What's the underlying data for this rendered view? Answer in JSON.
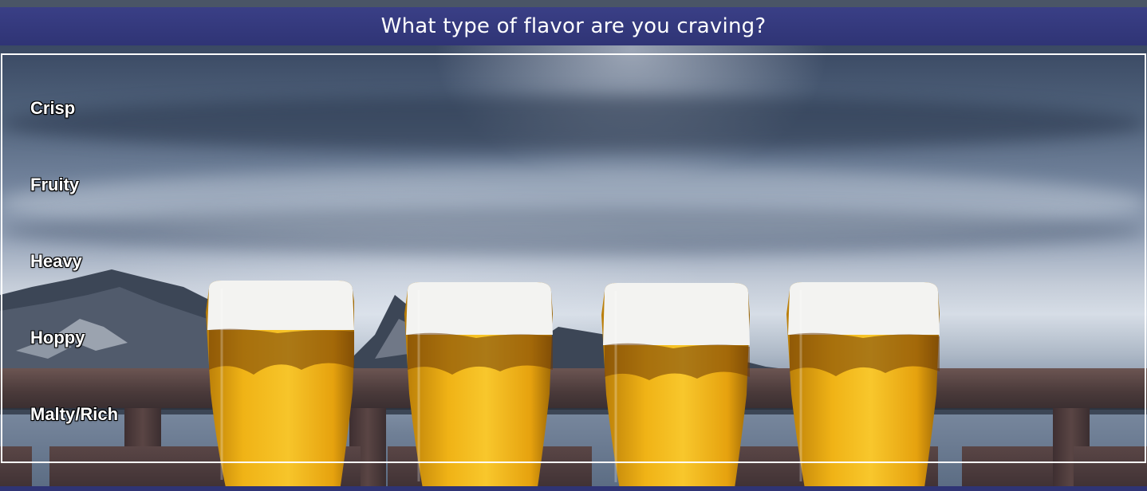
{
  "header": {
    "title": "What type of flavor are you craving?"
  },
  "options": [
    {
      "label": "Crisp"
    },
    {
      "label": "Fruity"
    },
    {
      "label": "Heavy"
    },
    {
      "label": "Hoppy"
    },
    {
      "label": "Malty/Rich"
    }
  ],
  "colors": {
    "header_bg": "#3a3f86",
    "panel_border": "#ffffff",
    "option_text": "#ffffff",
    "beer": "#f2b411",
    "foam": "#f4f4f2"
  },
  "background": {
    "image_subject": "beer-glasses-mountain-railing-photo"
  }
}
